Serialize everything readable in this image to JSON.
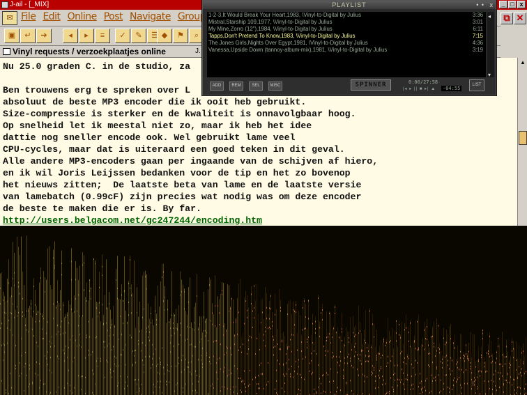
{
  "window": {
    "title": "J-ail - [_MIX]",
    "minimize": "_",
    "maximize": "□",
    "close": "x"
  },
  "menu": {
    "items": [
      "File",
      "Edit",
      "Online",
      "Post",
      "Navigate",
      "Group"
    ]
  },
  "tab": {
    "title": "Vinyl requests / verzoekplaatjes online",
    "extra": "J."
  },
  "message": {
    "lines": [
      "Nu 25.0 graden C. in de studio, za",
      "",
      "Ben trouwens erg te spreken over L",
      "absoluut de beste MP3 encoder die ik ooit heb gebruikt.",
      "Size-compressie is sterker en de kwaliteit is onnavolgbaar hoog.",
      "Op snelheid let ik meestal niet zo, maar ik heb het idee",
      "dattie nog sneller encode ook. Wel gebruikt lame veel",
      "CPU-cycles, maar dat is uiteraard een goed teken in dit geval.",
      "Alle andere MP3-encoders gaan per ingaande van de schijven af hiero,",
      "en ik wil Joris Leijssen bedanken voor de tip en het zo bovenop",
      "het nieuws zitten;  De laatste beta van lame en de laatste versie",
      "van lamebatch (0.99cF) zijn precies wat nodig was om deze encoder",
      "de beste te maken die er is. By far."
    ],
    "link": "http://users.belgacom.net/gc247244/encoding.htm"
  },
  "playlist": {
    "title": "PLAYLIST",
    "dots": "• •",
    "close": "x",
    "entries": [
      {
        "title": "1-2-3,It Would Break Your Heart,1983, \\Vinyl-to-Digital by Julius",
        "duration": "3:36",
        "active": false
      },
      {
        "title": "Mistral,Starship 109,1977, \\Vinyl-to-Digital by Julius",
        "duration": "3:01",
        "active": false
      },
      {
        "title": "My Mine,Zorro (12\"),1984, \\Vinyl-to-Digital by Julius",
        "duration": "6:11",
        "active": false
      },
      {
        "title": "Tapps,Don't Pretend To Know,1983, \\Vinyl-to-Digital by Julius",
        "duration": "7:15",
        "active": true
      },
      {
        "title": "The Jones Girls,Nights Over Egypt,1981, \\Vinyl-to-Digital by Julius",
        "duration": "4:36",
        "active": false
      },
      {
        "title": "Vanessa,Upside Down (tannoy-album-mix),1981, \\Vinyl-to-Digital by Julius",
        "duration": "3:19",
        "active": false
      }
    ],
    "buttons": {
      "add": "ADD",
      "rem": "REM",
      "sel": "SEL",
      "misc": "MISC",
      "list": "LIST"
    },
    "skin_label": "SPINNER",
    "time_total": "0:00/27:58",
    "time_remaining": "-04:55",
    "controls": "|◂ ▸ || ■ ▸| ▲"
  },
  "colors": {
    "titlebar": "#b80000",
    "menu_text": "#a05000",
    "message_bg": "#fffbe4",
    "link": "#006400",
    "playlist_active": "#ffff9a",
    "playlist_text": "#9aaa9a"
  },
  "visualizer": {
    "style": "spectrum",
    "palette": [
      "#6b5a10",
      "#a08a20",
      "#3a2800",
      "#c07030"
    ]
  }
}
